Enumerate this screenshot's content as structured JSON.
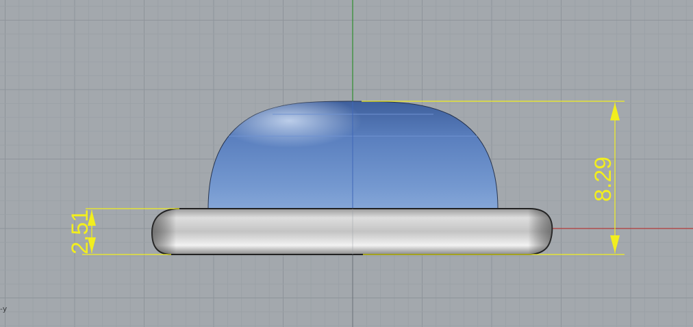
{
  "viewport": {
    "background_color": "#a3a8ad",
    "grid_minor_color": "#9aa0a6",
    "grid_major_color": "#8e949a",
    "axis_label": "-y"
  },
  "axes": {
    "vertical_axis_color": "#2f8f2f",
    "horizontal_axis_color": "#b23a3a"
  },
  "model": {
    "dome_color": "#5f86c4",
    "base_color": "#c7c7c7",
    "outline_color": "#1a1a1a"
  },
  "dimensions": {
    "color": "#f2ee1e",
    "left_label": "2.51",
    "right_label": "8.29"
  }
}
